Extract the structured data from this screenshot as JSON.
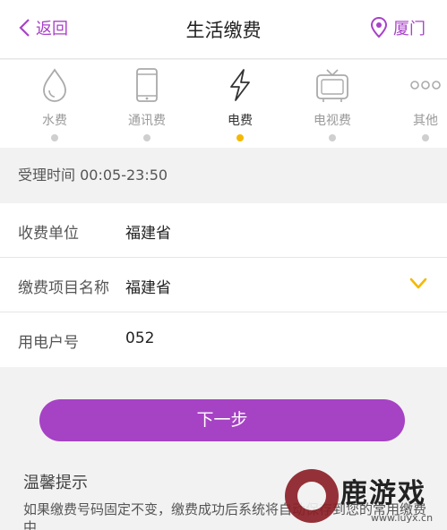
{
  "header": {
    "back_label": "返回",
    "title": "生活缴费",
    "city": "厦门"
  },
  "categories": [
    {
      "label": "水费",
      "icon": "water-drop-icon",
      "active": false
    },
    {
      "label": "通讯费",
      "icon": "phone-icon",
      "active": false
    },
    {
      "label": "电费",
      "icon": "lightning-icon",
      "active": true
    },
    {
      "label": "电视费",
      "icon": "tv-icon",
      "active": false
    },
    {
      "label": "其他",
      "icon": "more-icon",
      "active": false
    }
  ],
  "service_hours": "受理时间 00:05-23:50",
  "form": {
    "payee_label": "收费单位",
    "payee_value": "福建省",
    "item_label": "缴费项目名称",
    "item_value": "福建省",
    "account_label": "用电户号",
    "account_value": "052"
  },
  "next_button": "下一步",
  "tips": {
    "title": "温馨提示",
    "text": "如果缴费号码固定不变，缴费成功后系统将自动保存到您的常用缴费中"
  },
  "watermark": {
    "text": "鹿游戏",
    "url": "www.luyx.cn"
  },
  "colors": {
    "accent": "#a842c8",
    "active_dot": "#f5b800"
  }
}
